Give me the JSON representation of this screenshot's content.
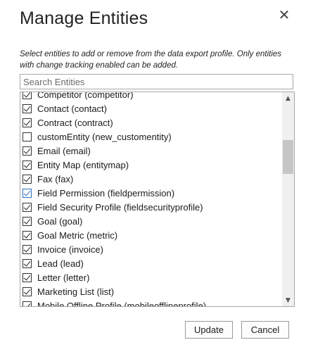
{
  "dialog": {
    "title": "Manage Entities",
    "close_glyph": "✕",
    "description": "Select entities to add or remove from the data export profile. Only entities with change tracking enabled can be added."
  },
  "search": {
    "placeholder": "Search Entities",
    "value": ""
  },
  "entities": [
    {
      "label": "Competitor (competitor)",
      "checked": true
    },
    {
      "label": "Contact (contact)",
      "checked": true
    },
    {
      "label": "Contract (contract)",
      "checked": true
    },
    {
      "label": "customEntity (new_customentity)",
      "checked": false
    },
    {
      "label": "Email (email)",
      "checked": true
    },
    {
      "label": "Entity Map (entitymap)",
      "checked": true
    },
    {
      "label": "Fax (fax)",
      "checked": true
    },
    {
      "label": "Field Permission (fieldpermission)",
      "checked": true,
      "focused": true
    },
    {
      "label": "Field Security Profile (fieldsecurityprofile)",
      "checked": true
    },
    {
      "label": "Goal (goal)",
      "checked": true
    },
    {
      "label": "Goal Metric (metric)",
      "checked": true
    },
    {
      "label": "Invoice (invoice)",
      "checked": true
    },
    {
      "label": "Lead (lead)",
      "checked": true
    },
    {
      "label": "Letter (letter)",
      "checked": true
    },
    {
      "label": "Marketing List (list)",
      "checked": true
    },
    {
      "label": "Mobile Offline Profile (mobileofflineprofile)",
      "checked": true
    }
  ],
  "buttons": {
    "update": "Update",
    "cancel": "Cancel"
  },
  "scrollbar": {
    "up_glyph": "⌃",
    "down_glyph": "⌄"
  }
}
